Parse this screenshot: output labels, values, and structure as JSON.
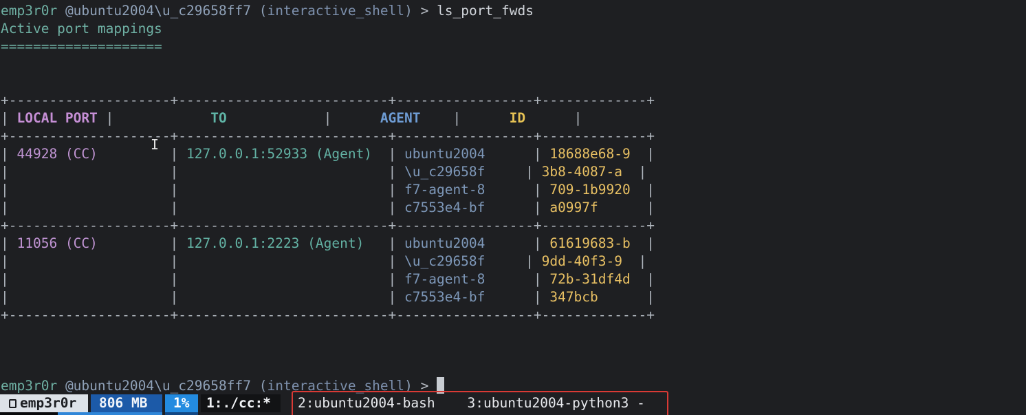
{
  "prompt": {
    "user": "emp3r0r",
    "host": "@ubuntu2004\\u_c29658ff7",
    "shell": "interactive_shell",
    "symbol": ">"
  },
  "command": "ls_port_fwds",
  "output": {
    "title": "Active port mappings",
    "underline": "===================="
  },
  "table": {
    "border_line": "+--------------------+--------------------------+-----------------+-------------+",
    "headers": {
      "local_port": "LOCAL PORT",
      "to": "TO",
      "agent": "AGENT",
      "id": "ID"
    },
    "rows": [
      {
        "local_port": "44928 (CC)",
        "to": "127.0.0.1:52933 (Agent)",
        "agent": [
          "ubuntu2004",
          "\\u_c29658f",
          "f7-agent-8",
          "c7553e4-bf"
        ],
        "id": [
          "18688e68-9",
          "3b8-4087-a",
          "709-1b9920",
          "a0997f"
        ]
      },
      {
        "local_port": "11056 (CC)",
        "to": "127.0.0.1:2223 (Agent)",
        "agent": [
          "ubuntu2004",
          "\\u_c29658f",
          "f7-agent-8",
          "c7553e4-bf"
        ],
        "id": [
          "61619683-b",
          "9dd-40f3-9",
          "72b-31df4d",
          "347bcb"
        ]
      }
    ]
  },
  "status_bar": {
    "session": "emp3r0r",
    "memory": "806 MB",
    "cpu": "1%",
    "active_window": "1:./cc:*",
    "windows": "2:ubuntu2004-bash    3:ubuntu2004-python3 -"
  },
  "colors": {
    "background": "#1e1f22",
    "session_bg": "#dde2e8",
    "memory_bg": "#1c5aa8",
    "cpu_bg": "#238be0",
    "highlight_box": "#d93a35"
  }
}
